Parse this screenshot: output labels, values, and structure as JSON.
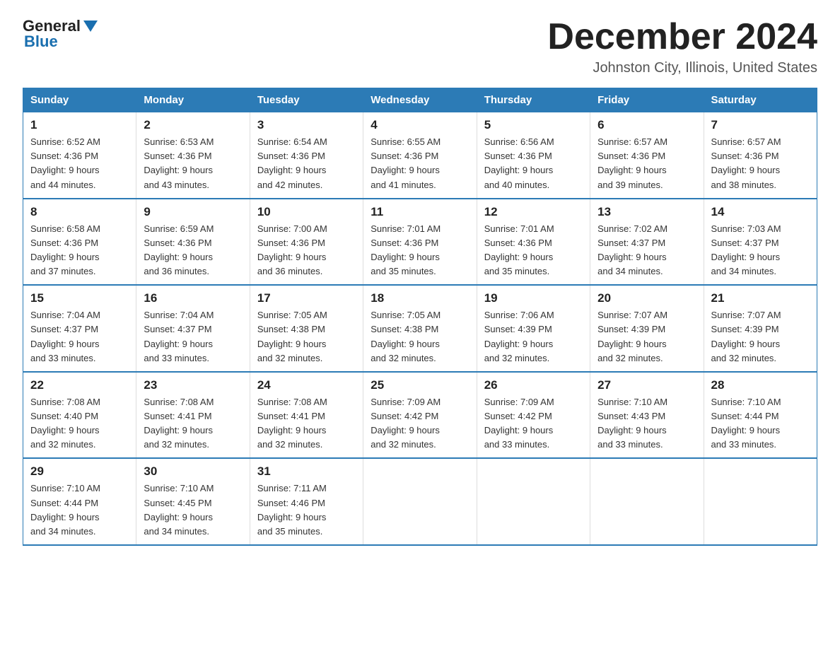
{
  "logo": {
    "general": "General",
    "blue": "Blue"
  },
  "title": "December 2024",
  "location": "Johnston City, Illinois, United States",
  "days_header": [
    "Sunday",
    "Monday",
    "Tuesday",
    "Wednesday",
    "Thursday",
    "Friday",
    "Saturday"
  ],
  "weeks": [
    [
      {
        "num": "1",
        "sunrise": "6:52 AM",
        "sunset": "4:36 PM",
        "daylight": "9 hours and 44 minutes."
      },
      {
        "num": "2",
        "sunrise": "6:53 AM",
        "sunset": "4:36 PM",
        "daylight": "9 hours and 43 minutes."
      },
      {
        "num": "3",
        "sunrise": "6:54 AM",
        "sunset": "4:36 PM",
        "daylight": "9 hours and 42 minutes."
      },
      {
        "num": "4",
        "sunrise": "6:55 AM",
        "sunset": "4:36 PM",
        "daylight": "9 hours and 41 minutes."
      },
      {
        "num": "5",
        "sunrise": "6:56 AM",
        "sunset": "4:36 PM",
        "daylight": "9 hours and 40 minutes."
      },
      {
        "num": "6",
        "sunrise": "6:57 AM",
        "sunset": "4:36 PM",
        "daylight": "9 hours and 39 minutes."
      },
      {
        "num": "7",
        "sunrise": "6:57 AM",
        "sunset": "4:36 PM",
        "daylight": "9 hours and 38 minutes."
      }
    ],
    [
      {
        "num": "8",
        "sunrise": "6:58 AM",
        "sunset": "4:36 PM",
        "daylight": "9 hours and 37 minutes."
      },
      {
        "num": "9",
        "sunrise": "6:59 AM",
        "sunset": "4:36 PM",
        "daylight": "9 hours and 36 minutes."
      },
      {
        "num": "10",
        "sunrise": "7:00 AM",
        "sunset": "4:36 PM",
        "daylight": "9 hours and 36 minutes."
      },
      {
        "num": "11",
        "sunrise": "7:01 AM",
        "sunset": "4:36 PM",
        "daylight": "9 hours and 35 minutes."
      },
      {
        "num": "12",
        "sunrise": "7:01 AM",
        "sunset": "4:36 PM",
        "daylight": "9 hours and 35 minutes."
      },
      {
        "num": "13",
        "sunrise": "7:02 AM",
        "sunset": "4:37 PM",
        "daylight": "9 hours and 34 minutes."
      },
      {
        "num": "14",
        "sunrise": "7:03 AM",
        "sunset": "4:37 PM",
        "daylight": "9 hours and 34 minutes."
      }
    ],
    [
      {
        "num": "15",
        "sunrise": "7:04 AM",
        "sunset": "4:37 PM",
        "daylight": "9 hours and 33 minutes."
      },
      {
        "num": "16",
        "sunrise": "7:04 AM",
        "sunset": "4:37 PM",
        "daylight": "9 hours and 33 minutes."
      },
      {
        "num": "17",
        "sunrise": "7:05 AM",
        "sunset": "4:38 PM",
        "daylight": "9 hours and 32 minutes."
      },
      {
        "num": "18",
        "sunrise": "7:05 AM",
        "sunset": "4:38 PM",
        "daylight": "9 hours and 32 minutes."
      },
      {
        "num": "19",
        "sunrise": "7:06 AM",
        "sunset": "4:39 PM",
        "daylight": "9 hours and 32 minutes."
      },
      {
        "num": "20",
        "sunrise": "7:07 AM",
        "sunset": "4:39 PM",
        "daylight": "9 hours and 32 minutes."
      },
      {
        "num": "21",
        "sunrise": "7:07 AM",
        "sunset": "4:39 PM",
        "daylight": "9 hours and 32 minutes."
      }
    ],
    [
      {
        "num": "22",
        "sunrise": "7:08 AM",
        "sunset": "4:40 PM",
        "daylight": "9 hours and 32 minutes."
      },
      {
        "num": "23",
        "sunrise": "7:08 AM",
        "sunset": "4:41 PM",
        "daylight": "9 hours and 32 minutes."
      },
      {
        "num": "24",
        "sunrise": "7:08 AM",
        "sunset": "4:41 PM",
        "daylight": "9 hours and 32 minutes."
      },
      {
        "num": "25",
        "sunrise": "7:09 AM",
        "sunset": "4:42 PM",
        "daylight": "9 hours and 32 minutes."
      },
      {
        "num": "26",
        "sunrise": "7:09 AM",
        "sunset": "4:42 PM",
        "daylight": "9 hours and 33 minutes."
      },
      {
        "num": "27",
        "sunrise": "7:10 AM",
        "sunset": "4:43 PM",
        "daylight": "9 hours and 33 minutes."
      },
      {
        "num": "28",
        "sunrise": "7:10 AM",
        "sunset": "4:44 PM",
        "daylight": "9 hours and 33 minutes."
      }
    ],
    [
      {
        "num": "29",
        "sunrise": "7:10 AM",
        "sunset": "4:44 PM",
        "daylight": "9 hours and 34 minutes."
      },
      {
        "num": "30",
        "sunrise": "7:10 AM",
        "sunset": "4:45 PM",
        "daylight": "9 hours and 34 minutes."
      },
      {
        "num": "31",
        "sunrise": "7:11 AM",
        "sunset": "4:46 PM",
        "daylight": "9 hours and 35 minutes."
      },
      null,
      null,
      null,
      null
    ]
  ]
}
